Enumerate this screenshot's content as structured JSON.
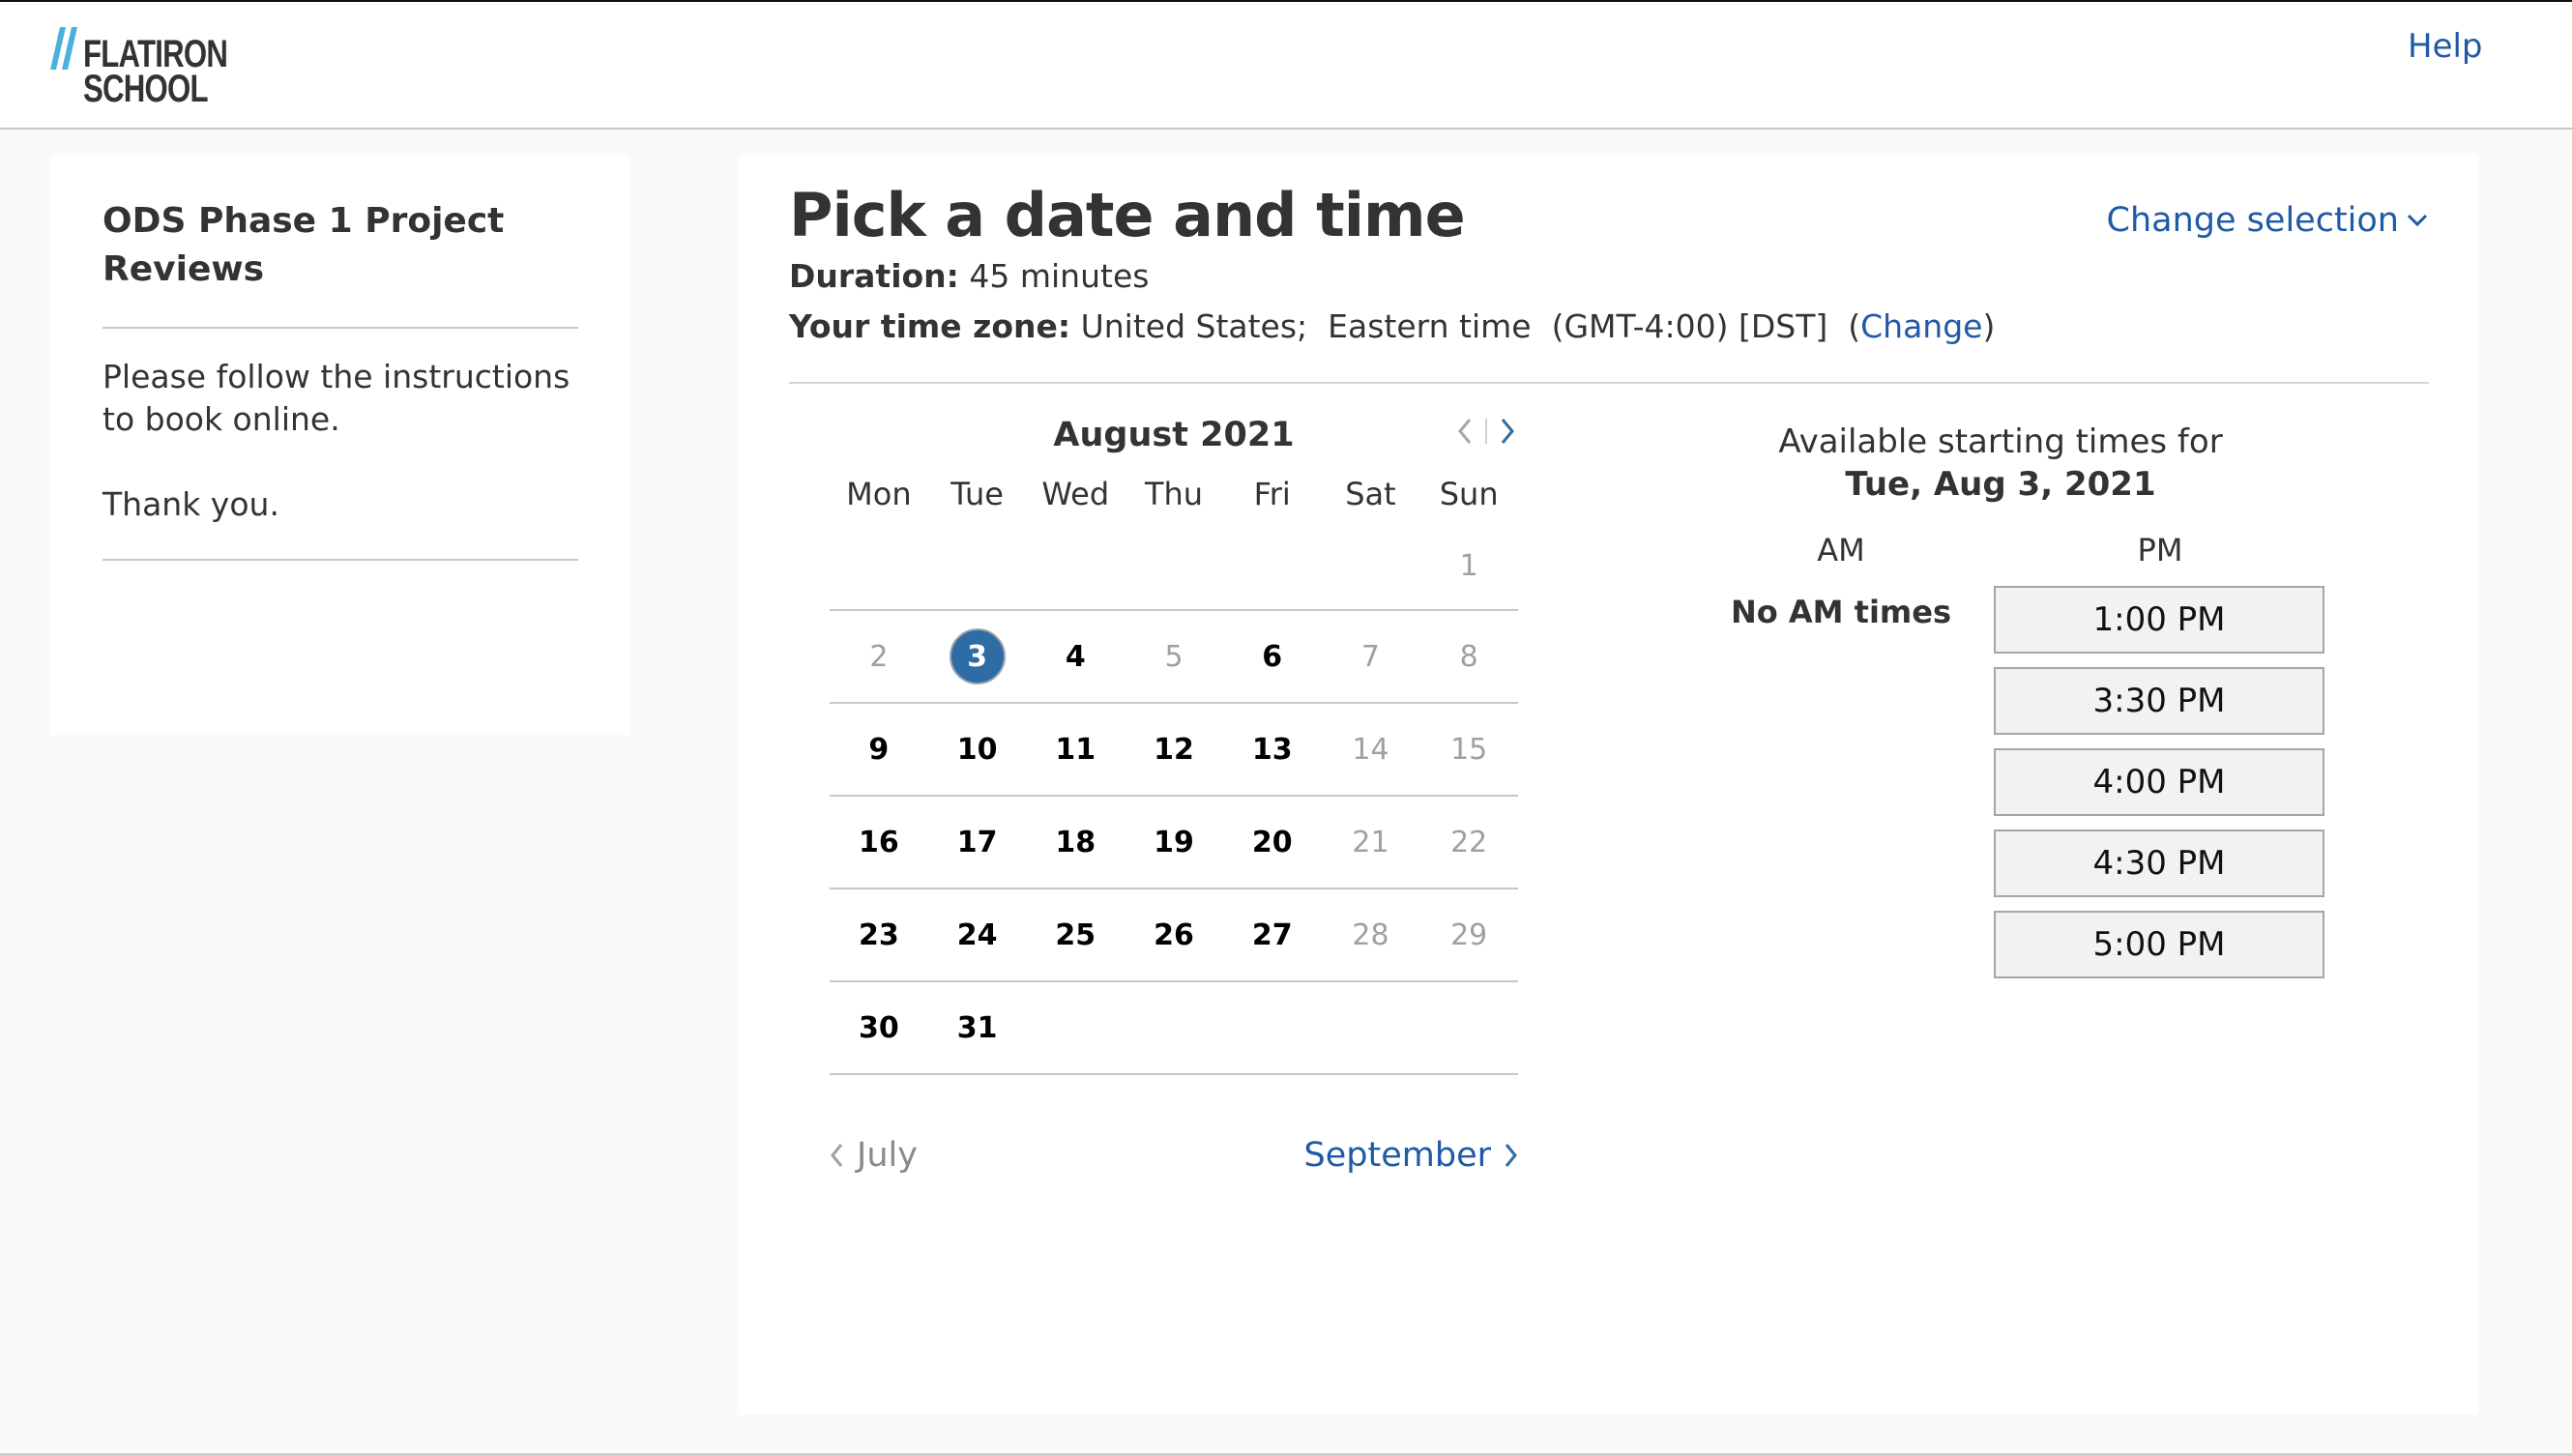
{
  "header": {
    "logo": {
      "line1": "FLATIRON",
      "line2": "SCHOOL",
      "slash_color": "#4ab1dc"
    },
    "help_label": "Help"
  },
  "sidebar": {
    "title": "ODS Phase 1 Project Reviews",
    "paragraphs": [
      "Please follow the instructions to book online.",
      "Thank you."
    ]
  },
  "main": {
    "title": "Pick a date and time",
    "change_selection_label": "Change selection",
    "duration_label": "Duration:",
    "duration_value": " 45 minutes",
    "timezone_label": "Your time zone:",
    "timezone_value": " United States;  Eastern time  (GMT-4:00) [DST]  (",
    "timezone_change_label": "Change",
    "timezone_close": ")"
  },
  "calendar": {
    "month_title": "August 2021",
    "weekdays": [
      "Mon",
      "Tue",
      "Wed",
      "Thu",
      "Fri",
      "Sat",
      "Sun"
    ],
    "weeks": [
      [
        null,
        null,
        null,
        null,
        null,
        null,
        {
          "d": "1",
          "s": "unavail"
        }
      ],
      [
        {
          "d": "2",
          "s": "unavail"
        },
        {
          "d": "3",
          "s": "selected"
        },
        {
          "d": "4",
          "s": "avail"
        },
        {
          "d": "5",
          "s": "unavail"
        },
        {
          "d": "6",
          "s": "avail"
        },
        {
          "d": "7",
          "s": "unavail"
        },
        {
          "d": "8",
          "s": "unavail"
        }
      ],
      [
        {
          "d": "9",
          "s": "avail"
        },
        {
          "d": "10",
          "s": "avail"
        },
        {
          "d": "11",
          "s": "avail"
        },
        {
          "d": "12",
          "s": "avail"
        },
        {
          "d": "13",
          "s": "avail"
        },
        {
          "d": "14",
          "s": "unavail"
        },
        {
          "d": "15",
          "s": "unavail"
        }
      ],
      [
        {
          "d": "16",
          "s": "avail"
        },
        {
          "d": "17",
          "s": "avail"
        },
        {
          "d": "18",
          "s": "avail"
        },
        {
          "d": "19",
          "s": "avail"
        },
        {
          "d": "20",
          "s": "avail"
        },
        {
          "d": "21",
          "s": "unavail"
        },
        {
          "d": "22",
          "s": "unavail"
        }
      ],
      [
        {
          "d": "23",
          "s": "avail"
        },
        {
          "d": "24",
          "s": "avail"
        },
        {
          "d": "25",
          "s": "avail"
        },
        {
          "d": "26",
          "s": "avail"
        },
        {
          "d": "27",
          "s": "avail"
        },
        {
          "d": "28",
          "s": "unavail"
        },
        {
          "d": "29",
          "s": "unavail"
        }
      ],
      [
        {
          "d": "30",
          "s": "avail"
        },
        {
          "d": "31",
          "s": "avail"
        },
        null,
        null,
        null,
        null,
        null
      ]
    ],
    "prev_month_label": "July",
    "next_month_label": "September",
    "selected_color": "#2e6da4"
  },
  "times": {
    "heading": "Available starting times for",
    "selected_date": "Tue, Aug 3, 2021",
    "am_label": "AM",
    "pm_label": "PM",
    "no_am_text": "No AM times",
    "pm_slots": [
      "1:00 PM",
      "3:30 PM",
      "4:00 PM",
      "4:30 PM",
      "5:00 PM"
    ]
  }
}
